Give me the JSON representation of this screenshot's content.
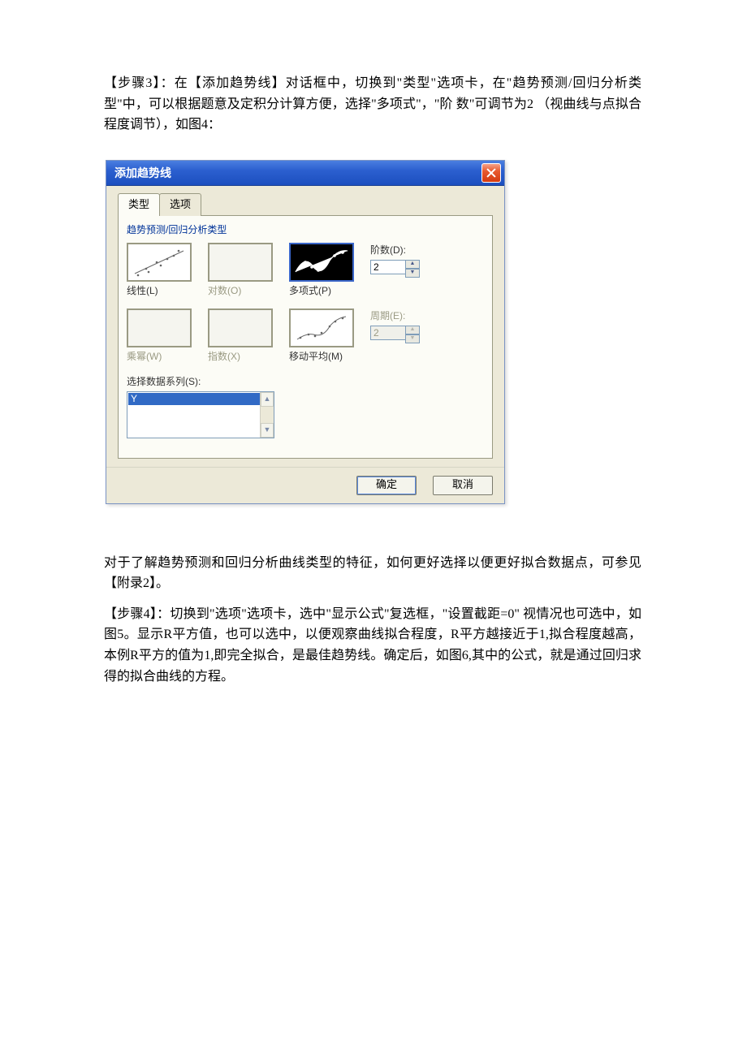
{
  "paragraphs": {
    "p1": "【步骤3】：在【添加趋势线】对话框中，切换到\"类型\"选项卡，在\"趋势预测/回归分析类型\"中，可以根据题意及定积分计算方便，选择\"多项式\"，\"阶 数\"可调节为2 （视曲线与点拟合程度调节），如图4：",
    "p2": "对于了解趋势预测和回归分析曲线类型的特征，如何更好选择以便更好拟合数据点，可参见【附录2】。",
    "p3": "【步骤4】：切换到\"选项\"选项卡，选中\"显示公式\"复选框，\"设置截距=0\" 视情况也可选中，如图5。显示R平方值，也可以选中，以便观察曲线拟合程度，R平方越接近于1,拟合程度越高，本例R平方的值为1,即完全拟合，是最佳趋势线。确定后，如图6,其中的公式，就是通过回归求得的拟合曲线的方程。"
  },
  "dialog": {
    "title": "添加趋势线",
    "tabs": {
      "type": "类型",
      "options": "选项"
    },
    "section_label": "趋势预测/回归分析类型",
    "types": {
      "linear": "线性(L)",
      "log": "对数(O)",
      "poly": "多项式(P)",
      "power": "乘幂(W)",
      "exp": "指数(X)",
      "movavg": "移动平均(M)"
    },
    "order": {
      "label": "阶数(D):",
      "value": "2"
    },
    "period": {
      "label": "周期(E):",
      "value": "2"
    },
    "series": {
      "label": "选择数据系列(S):",
      "item": "Y"
    },
    "buttons": {
      "ok": "确定",
      "cancel": "取消"
    }
  }
}
